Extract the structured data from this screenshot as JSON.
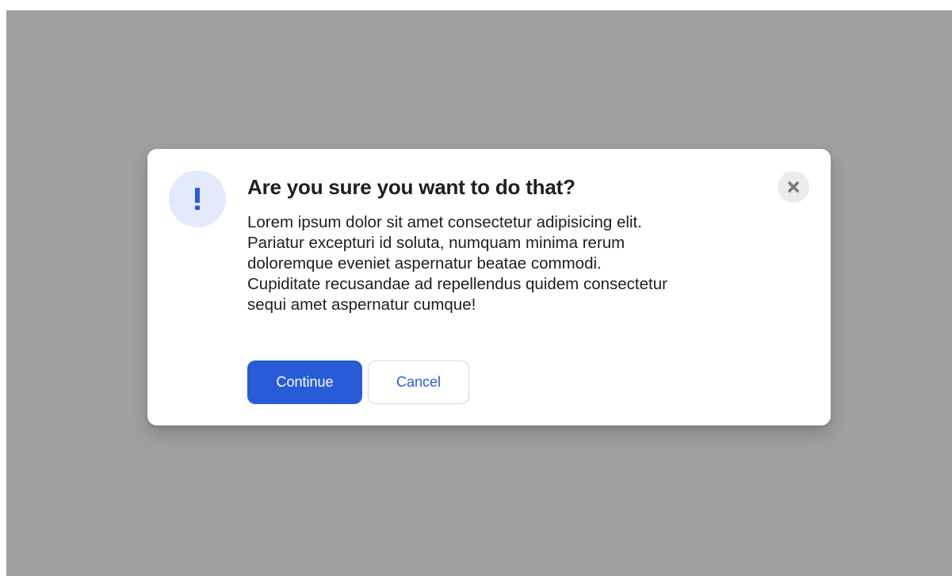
{
  "dialog": {
    "title": "Are you sure you want to do that?",
    "body_lines": [
      "Lorem ipsum dolor sit amet consectetur adipisicing elit.",
      "Pariatur excepturi id soluta, numquam minima rerum",
      "doloremque eveniet aspernatur beatae commodi.",
      "Cupiditate recusandae ad repellendus quidem consectetur",
      "sequi amet aspernatur cumque!"
    ],
    "alert_glyph": "!",
    "close_icon": "close-icon",
    "actions": {
      "continue_label": "Continue",
      "cancel_label": "Cancel"
    }
  },
  "colors": {
    "overlay": "#a0a0a0",
    "primary": "#2a5bd7",
    "primary_text": "#ffffff",
    "secondary_text": "#2a5bd7",
    "alert_bg": "#e4e8fb",
    "alert_fg": "#2a5bd7",
    "close_bg": "#ebebeb",
    "close_fg": "#7a7a7a"
  }
}
